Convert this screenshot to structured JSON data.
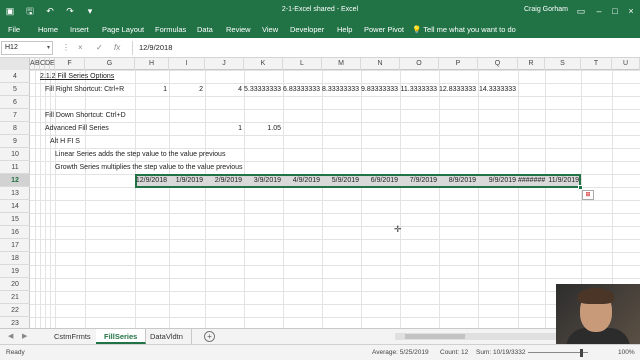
{
  "titlebar": {
    "title": "2-1-Excel shared  -  Excel",
    "user": "Craig Gorham",
    "quick_access": [
      "save-icon",
      "undo-icon",
      "redo-icon"
    ],
    "window_controls": [
      "ribbon-display-icon",
      "minimize-icon",
      "maximize-icon",
      "close-icon"
    ]
  },
  "ribbon": {
    "tabs": [
      "File",
      "Home",
      "Insert",
      "Page Layout",
      "Formulas",
      "Data",
      "Review",
      "View",
      "Developer",
      "Help",
      "Power Pivot"
    ],
    "tellme": "Tell me what you want to do"
  },
  "formulabar": {
    "namebox": "H12",
    "cancel": "×",
    "enter": "✓",
    "fx": "fx",
    "formula": "12/9/2018"
  },
  "columns": [
    "A",
    "B",
    "C",
    "D",
    "E",
    "F",
    "G",
    "H",
    "I",
    "J",
    "K",
    "L",
    "M",
    "N",
    "O",
    "P",
    "Q",
    "R",
    "S",
    "T",
    "U"
  ],
  "rows": [
    "4",
    "5",
    "6",
    "7",
    "8",
    "9",
    "10",
    "11",
    "12",
    "13",
    "14",
    "15",
    "16",
    "17",
    "18",
    "19",
    "20",
    "21",
    "22",
    "23"
  ],
  "selected_row": "12",
  "cells": {
    "r4": {
      "f": "2.1.2 Fill Series Options"
    },
    "r5": {
      "f": "Fill Right Shortcut: Ctrl+R",
      "h": "1",
      "i": "2",
      "j": "4",
      "k": "5.33333333",
      "l": "6.83333333",
      "m": "8.33333333",
      "n": "9.83333333",
      "o": "11.3333333",
      "p": "12.8333333",
      "q": "14.3333333"
    },
    "r7": {
      "f": "Fill Down Shortcut: Ctrl+D"
    },
    "r8": {
      "f": "Advanced Fill Series",
      "j": "1",
      "k": "1.05"
    },
    "r9": {
      "f": "Alt H FI S"
    },
    "r10": {
      "f": "Linear Series adds the step value to the value previous"
    },
    "r11": {
      "f": "Growth Series multiplies the step value to the value previous"
    },
    "r12": {
      "h": "12/9/2018",
      "i": "1/9/2019",
      "j": "2/9/2019",
      "k": "3/9/2019",
      "l": "4/9/2019",
      "m": "5/9/2019",
      "n": "6/9/2019",
      "o": "7/9/2019",
      "p": "8/9/2019",
      "q": "9/9/2019",
      "r": "#######",
      "s": "11/9/2019"
    }
  },
  "sheets": {
    "tabs": [
      "CstmFrmts",
      "FillSeries",
      "DataVldtn"
    ],
    "active": "FillSeries",
    "add": "+"
  },
  "status": {
    "mode": "Ready",
    "average": "Average: 5/25/2019",
    "count": "Count: 12",
    "sum": "Sum: 10/19/3332",
    "zoom": "100%"
  }
}
